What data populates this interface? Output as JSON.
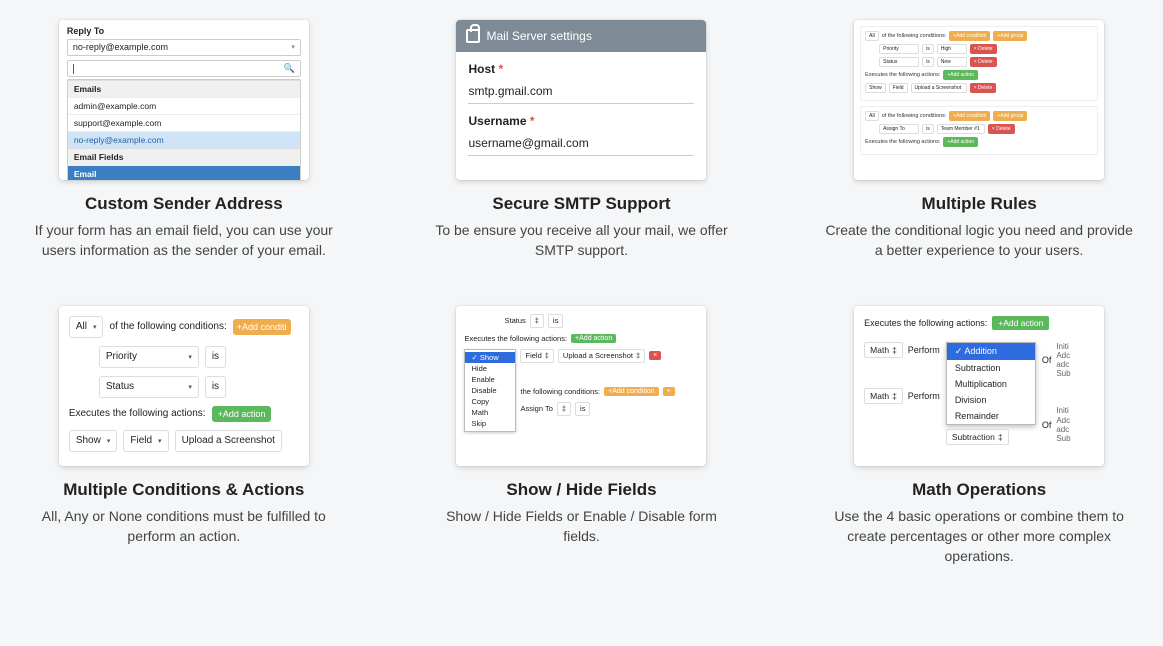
{
  "features": [
    {
      "title": "Custom Sender Address",
      "desc": "If your form has an email field, you can use your users information as the sender of your email."
    },
    {
      "title": "Secure SMTP Support",
      "desc": "To be ensure you receive all your mail, we offer SMTP support."
    },
    {
      "title": "Multiple Rules",
      "desc": "Create the conditional logic you need and provide a better experience to your users."
    },
    {
      "title": "Multiple Conditions & Actions",
      "desc": "All, Any or None conditions must be fulfilled to perform an action."
    },
    {
      "title": "Show / Hide Fields",
      "desc": "Show / Hide Fields or Enable / Disable form fields."
    },
    {
      "title": "Math Operations",
      "desc": "Use the 4 basic operations or combine them to create percentages or other more complex operations."
    }
  ],
  "card1": {
    "header": "Reply To",
    "selected": "no-reply@example.com",
    "search_placeholder": "",
    "sections": {
      "emails": "Emails",
      "emailFields": "Email Fields"
    },
    "items": [
      "admin@example.com",
      "support@example.com",
      "no-reply@example.com"
    ],
    "emailField": "Email"
  },
  "card2": {
    "title": "Mail Server settings",
    "hostLabel": "Host",
    "hostValue": "smtp.gmail.com",
    "userLabel": "Username",
    "userValue": "username@gmail.com",
    "required": "*"
  },
  "card3": {
    "allLabel": "All",
    "condText": "of the following conditions:",
    "addCondition": "+Add condition",
    "addGroup": "+Add group",
    "fields": {
      "priority": "Priority",
      "status": "Status",
      "assignTo": "Assign To"
    },
    "ops": {
      "is": "is"
    },
    "vals": {
      "high": "High",
      "new": "New",
      "team": "Team Member #1"
    },
    "delete": "× Delete",
    "execText": "Executes the following actions:",
    "addAction": "+Add action",
    "show": "Show",
    "field": "Field",
    "upload": "Upload a Screenshot"
  },
  "card4": {
    "all": "All",
    "condText": "of the following conditions:",
    "addCondition": "+Add conditi",
    "priority": "Priority",
    "status": "Status",
    "is": "is",
    "execText": "Executes the following actions:",
    "addAction": "+Add action",
    "show": "Show",
    "field": "Field",
    "upload": "Upload a Screenshot"
  },
  "card5": {
    "status": "Status",
    "is": "is",
    "execText": "Executes the following actions:",
    "addAction": "+Add action",
    "options": [
      "Show",
      "Hide",
      "Enable",
      "Disable",
      "Copy",
      "Math",
      "Skip"
    ],
    "field": "Field",
    "upload": "Upload a Screenshot",
    "condText2": "the following conditions:",
    "addCondition": "+Add condition",
    "assignTo": "Assign To"
  },
  "card6": {
    "execText": "Executes the following actions:",
    "addAction": "+Add action",
    "math": "Math",
    "perform": "Perform",
    "of": "Of",
    "options": [
      "Addition",
      "Subtraction",
      "Multiplication",
      "Division",
      "Remainder"
    ],
    "trunc": [
      "Initi",
      "Adc",
      "adc",
      "Sub"
    ],
    "trunc2": [
      "Initi",
      "Adc",
      "adc",
      "Sub"
    ],
    "subtraction": "Subtraction"
  }
}
